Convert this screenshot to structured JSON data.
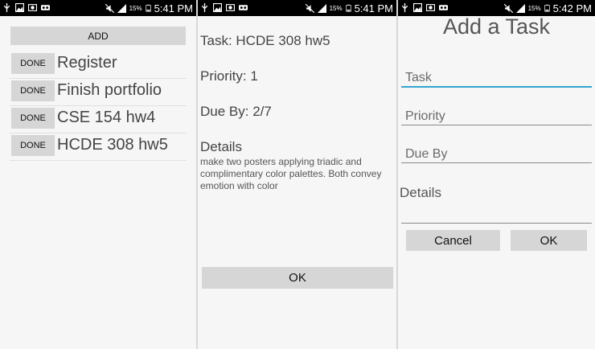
{
  "status": {
    "battery_pct": "15%",
    "times": [
      "5:41 PM",
      "5:41 PM",
      "5:42 PM"
    ]
  },
  "list_screen": {
    "add_label": "ADD",
    "done_label": "DONE",
    "tasks": [
      "Register",
      "Finish portfolio",
      "CSE 154 hw4",
      "HCDE 308 hw5"
    ]
  },
  "detail_screen": {
    "task_line": "Task: HCDE 308 hw5",
    "priority_line": "Priority: 1",
    "due_line": "Due By: 2/7",
    "details_heading": "Details",
    "details_text": "make two posters applying triadic and complimentary color palettes. Both convey emotion with color",
    "ok_label": "OK"
  },
  "add_screen": {
    "title": "Add a Task",
    "task_placeholder": "Task",
    "priority_placeholder": "Priority",
    "due_placeholder": "Due By",
    "details_label": "Details",
    "cancel_label": "Cancel",
    "ok_label": "OK"
  },
  "colors": {
    "focus_underline": "#33a6d0",
    "button_bg": "#d6d6d6",
    "screen_bg": "#f6f6f6"
  }
}
